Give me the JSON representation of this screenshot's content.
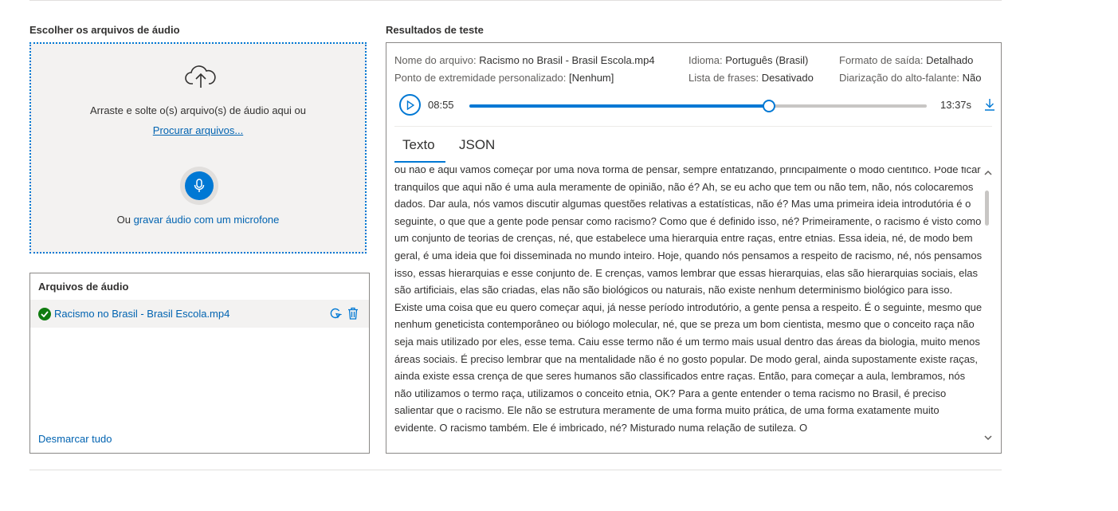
{
  "upload": {
    "section_label": "Escolher os arquivos de áudio",
    "drop_text": "Arraste e solte o(s) arquivo(s) de áudio aqui ou",
    "browse_link": "Procurar arquivos...",
    "mic_prefix": "Ou",
    "mic_link": "gravar áudio com um microfone",
    "icons": [
      "cloud-upload-icon",
      "microphone-icon"
    ]
  },
  "audio_files": {
    "title": "Arquivos de áudio",
    "files": [
      {
        "name": "Racismo no Brasil - Brasil Escola.mp4",
        "status": "checked",
        "icons": [
          "retry-icon",
          "delete-icon"
        ]
      }
    ],
    "deselect_all": "Desmarcar tudo"
  },
  "results": {
    "section_label": "Resultados de teste",
    "meta": {
      "file_label": "Nome do arquivo:",
      "file_value": "Racismo no Brasil - Brasil Escola.mp4",
      "language_label": "Idioma:",
      "language_value": "Português (Brasil)",
      "format_label": "Formato de saída:",
      "format_value": "Detalhado",
      "endpoint_label": "Ponto de extremidade personalizado:",
      "endpoint_value": "[Nenhum]",
      "phrases_label": "Lista de frases:",
      "phrases_value": "Desativado",
      "diarization_label": "Diarização do alto-falante:",
      "diarization_value": "Não"
    },
    "player": {
      "current_time": "08:55",
      "total_time": "13:37s",
      "progress": 0.655
    },
    "tabs": [
      "Texto",
      "JSON"
    ],
    "active_tab": "Texto",
    "transcript": "ou não e aqui vamos começar por uma nova forma de pensar, sempre enfatizando, principalmente o modo científico. Pode ficar tranquilos que aqui não é uma aula meramente de opinião, não é? Ah, se eu acho que tem ou não tem, não, nós colocaremos dados. Dar aula, nós vamos discutir algumas questões relativas a estatísticas, não é? Mas uma primeira ideia introdutória é o seguinte, o que que a gente pode pensar como racismo? Como que é definido isso, né? Primeiramente, o racismo é visto como um conjunto de teorias de crenças, né, que estabelece uma hierarquia entre raças, entre etnias. Essa ideia, né, de modo bem geral, é uma ideia que foi disseminada no mundo inteiro. Hoje, quando nós pensamos a respeito de racismo, né, nós pensamos isso, essas hierarquias e esse conjunto de. E crenças, vamos lembrar que essas hierarquias, elas são hierarquias sociais, elas são artificiais, elas são criadas, elas não são biológicos ou naturais, não existe nenhum determinismo biológico para isso. Existe uma coisa que eu quero começar aqui, já nesse período introdutório, a gente pensa a respeito. É o seguinte, mesmo que nenhum geneticista contemporâneo ou biólogo molecular, né, que se preza um bom cientista, mesmo que o conceito raça não seja mais utilizado por eles, esse tema. Caiu esse termo não é um termo mais usual dentro das áreas da biologia, muito menos áreas sociais. É preciso lembrar que na mentalidade não é no gosto popular. De modo geral, ainda supostamente existe raças, ainda existe essa crença de que seres humanos são classificados entre raças. Então, para começar a aula, lembramos, nós não utilizamos o termo raça, utilizamos o conceito etnia, OK? Para a gente entender o tema racismo no Brasil, é preciso salientar que o racismo. Ele não se estrutura meramente de uma forma muito prática, de uma forma exatamente muito evidente. O racismo também. Ele é imbricado, né? Misturado numa relação de sutileza. O",
    "icons": [
      "play-icon",
      "download-icon",
      "scroll-up-icon",
      "scroll-down-icon"
    ]
  },
  "colors": {
    "accent": "#0078d4",
    "link": "#0063b1",
    "success": "#107c10"
  }
}
